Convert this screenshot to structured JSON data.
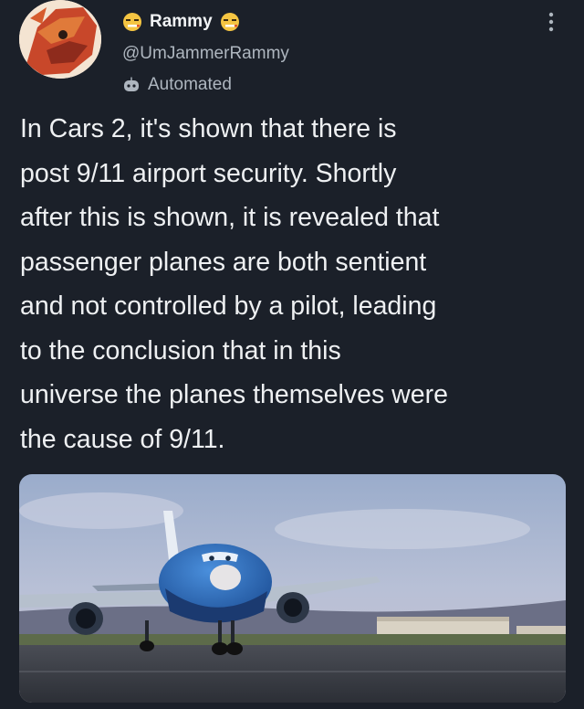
{
  "tweet": {
    "display_name": "Rammy",
    "handle": "@UmJammerRammy",
    "automated_label": "Automated",
    "text_lines": [
      "In Cars 2, it's shown that there is",
      "post 9/11 airport security. Shortly",
      "after this is shown, it is revealed that",
      "passenger planes are both sentient",
      "and not controlled by a pilot, leading",
      "to the conclusion that in this",
      "universe the planes themselves were",
      "the cause of 9/11."
    ]
  },
  "icons": {
    "name_emoji": "smoking-face-emoji",
    "automated": "robot-icon",
    "more": "vertical-ellipsis-icon"
  },
  "colors": {
    "background": "#1b2029",
    "primary_text": "#eef0f2",
    "secondary_text": "#aeb6bf",
    "plane_blue": "#2a68b8"
  }
}
